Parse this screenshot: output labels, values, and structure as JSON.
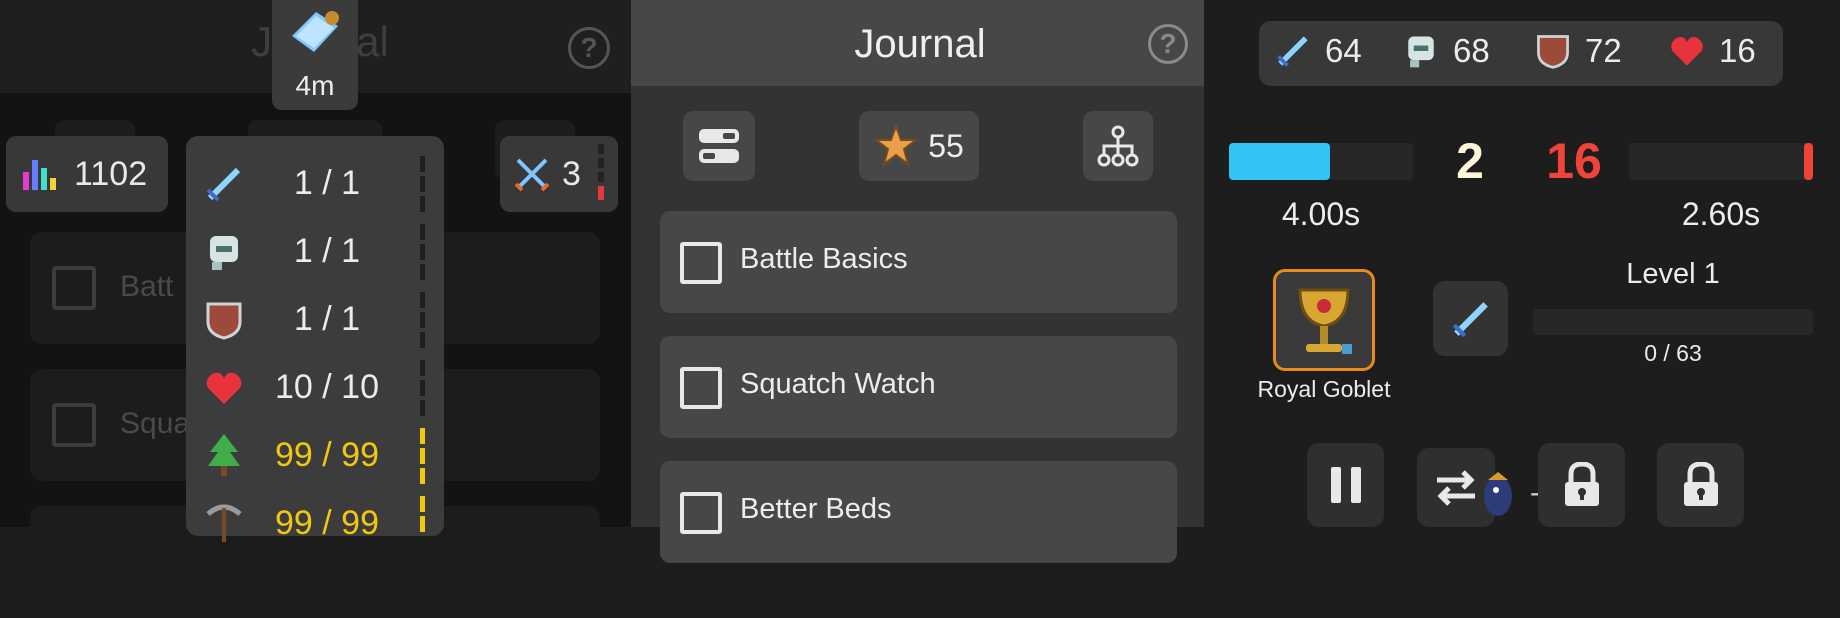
{
  "left": {
    "title": "Journal",
    "help_icon": "?",
    "stats_value": "1102",
    "battle_value": "3",
    "time_badge": "4m",
    "rows": [
      "Batt",
      "Squa"
    ],
    "popup": [
      {
        "icon": "sword-icon",
        "value": "1 / 1",
        "color": "white"
      },
      {
        "icon": "helmet-icon",
        "value": "1 / 1",
        "color": "white"
      },
      {
        "icon": "shield-icon",
        "value": "1 / 1",
        "color": "white"
      },
      {
        "icon": "heart-icon",
        "value": "10 / 10",
        "color": "white"
      },
      {
        "icon": "tree-icon",
        "value": "99 / 99",
        "color": "gold"
      },
      {
        "icon": "pickaxe-icon",
        "value": "99 / 99",
        "color": "gold"
      }
    ]
  },
  "middle": {
    "title": "Journal",
    "help_icon": "?",
    "star_count": "55",
    "quests": [
      "Battle Basics",
      "Squatch Watch",
      "Better Beds"
    ]
  },
  "right": {
    "stats": {
      "attack": "64",
      "helmet": "68",
      "shield": "72",
      "health": "16"
    },
    "player_count": "2",
    "enemy_count": "16",
    "player_progress": 0.55,
    "enemy_progress": 0.05,
    "player_time": "4.00s",
    "enemy_time": "2.60s",
    "item_name": "Royal Goblet",
    "level_label": "Level 1",
    "xp_label": "0 / 63",
    "xp_progress": 0,
    "swap_dash": "-",
    "colors": {
      "accent": "#33c4f5",
      "enemy": "#f04339",
      "gold": "#f2c70f",
      "goblet_border": "#e88a1a"
    }
  }
}
